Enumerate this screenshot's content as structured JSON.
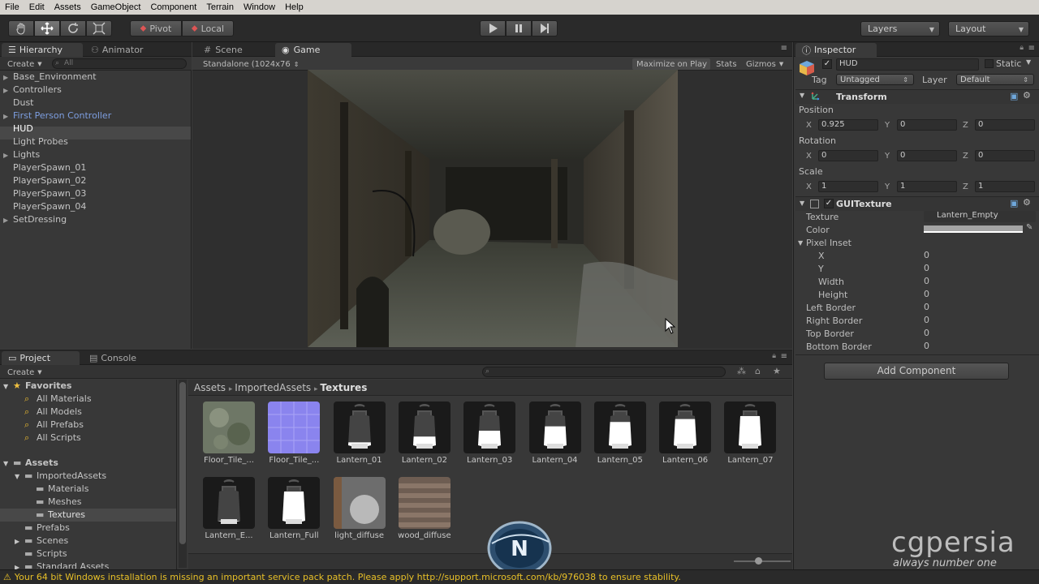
{
  "menu": [
    "File",
    "Edit",
    "Assets",
    "GameObject",
    "Component",
    "Terrain",
    "Window",
    "Help"
  ],
  "toolbar": {
    "pivot": "Pivot",
    "local": "Local",
    "layers": "Layers",
    "layout": "Layout"
  },
  "hierarchy": {
    "tab": "Hierarchy",
    "tab2": "Animator",
    "create": "Create",
    "search_placeholder": "All",
    "items": [
      {
        "label": "Base_Environment",
        "fold": true
      },
      {
        "label": "Controllers",
        "fold": true
      },
      {
        "label": "Dust",
        "fold": false
      },
      {
        "label": "First Person Controller",
        "fold": true
      },
      {
        "label": "HUD",
        "fold": false
      },
      {
        "label": "Light Probes",
        "fold": false
      },
      {
        "label": "Lights",
        "fold": true
      },
      {
        "label": "PlayerSpawn_01",
        "fold": false
      },
      {
        "label": "PlayerSpawn_02",
        "fold": false
      },
      {
        "label": "PlayerSpawn_03",
        "fold": false
      },
      {
        "label": "PlayerSpawn_04",
        "fold": false
      },
      {
        "label": "SetDressing",
        "fold": true
      }
    ]
  },
  "scene": {
    "tab_scene": "Scene",
    "tab_game": "Game",
    "resolution": "Standalone (1024x76",
    "maximize": "Maximize on Play",
    "stats": "Stats",
    "gizmos": "Gizmos"
  },
  "inspector": {
    "tab": "Inspector",
    "object_name": "HUD",
    "static": "Static",
    "tag_label": "Tag",
    "tag_value": "Untagged",
    "layer_label": "Layer",
    "layer_value": "Default",
    "transform": {
      "title": "Transform",
      "position": "Position",
      "rotation": "Rotation",
      "scale": "Scale",
      "pos": {
        "x": "0.925",
        "y": "0",
        "z": "0"
      },
      "rot": {
        "x": "0",
        "y": "0",
        "z": "0"
      },
      "scl": {
        "x": "1",
        "y": "1",
        "z": "1"
      }
    },
    "guitexture": {
      "title": "GUITexture",
      "texture_label": "Texture",
      "texture_value": "Lantern_Empty",
      "color_label": "Color",
      "pixel_inset": "Pixel Inset",
      "x_label": "X",
      "x_value": "0",
      "y_label": "Y",
      "y_value": "0",
      "width_label": "Width",
      "width_value": "0",
      "height_label": "Height",
      "height_value": "0",
      "left_border": "Left Border",
      "left_value": "0",
      "right_border": "Right Border",
      "right_value": "0",
      "top_border": "Top Border",
      "top_value": "0",
      "bottom_border": "Bottom Border",
      "bottom_value": "0"
    },
    "add_component": "Add Component"
  },
  "project": {
    "tab": "Project",
    "tab2": "Console",
    "create": "Create",
    "favorites": "Favorites",
    "fav_items": [
      "All Materials",
      "All Models",
      "All Prefabs",
      "All Scripts"
    ],
    "assets": "Assets",
    "imported": "ImportedAssets",
    "sub_items": [
      "Materials",
      "Meshes",
      "Textures"
    ],
    "other_items": [
      "Prefabs",
      "Scenes",
      "Scripts",
      "Standard Assets"
    ],
    "breadcrumb": [
      "Assets",
      "ImportedAssets",
      "Textures"
    ],
    "thumbs": [
      "Floor_Tile_...",
      "Floor_Tile_...",
      "Lantern_01",
      "Lantern_02",
      "Lantern_03",
      "Lantern_04",
      "Lantern_05",
      "Lantern_06",
      "Lantern_07",
      "Lantern_E...",
      "Lantern_Full",
      "light_diffuse",
      "wood_diffuse"
    ]
  },
  "status": "Your 64 bit Windows installation is missing an important service pack patch. Please apply http://support.microsoft.com/kb/976038 to ensure stability.",
  "watermark": {
    "brand": "cgpersia",
    "tagline": "always number one"
  }
}
